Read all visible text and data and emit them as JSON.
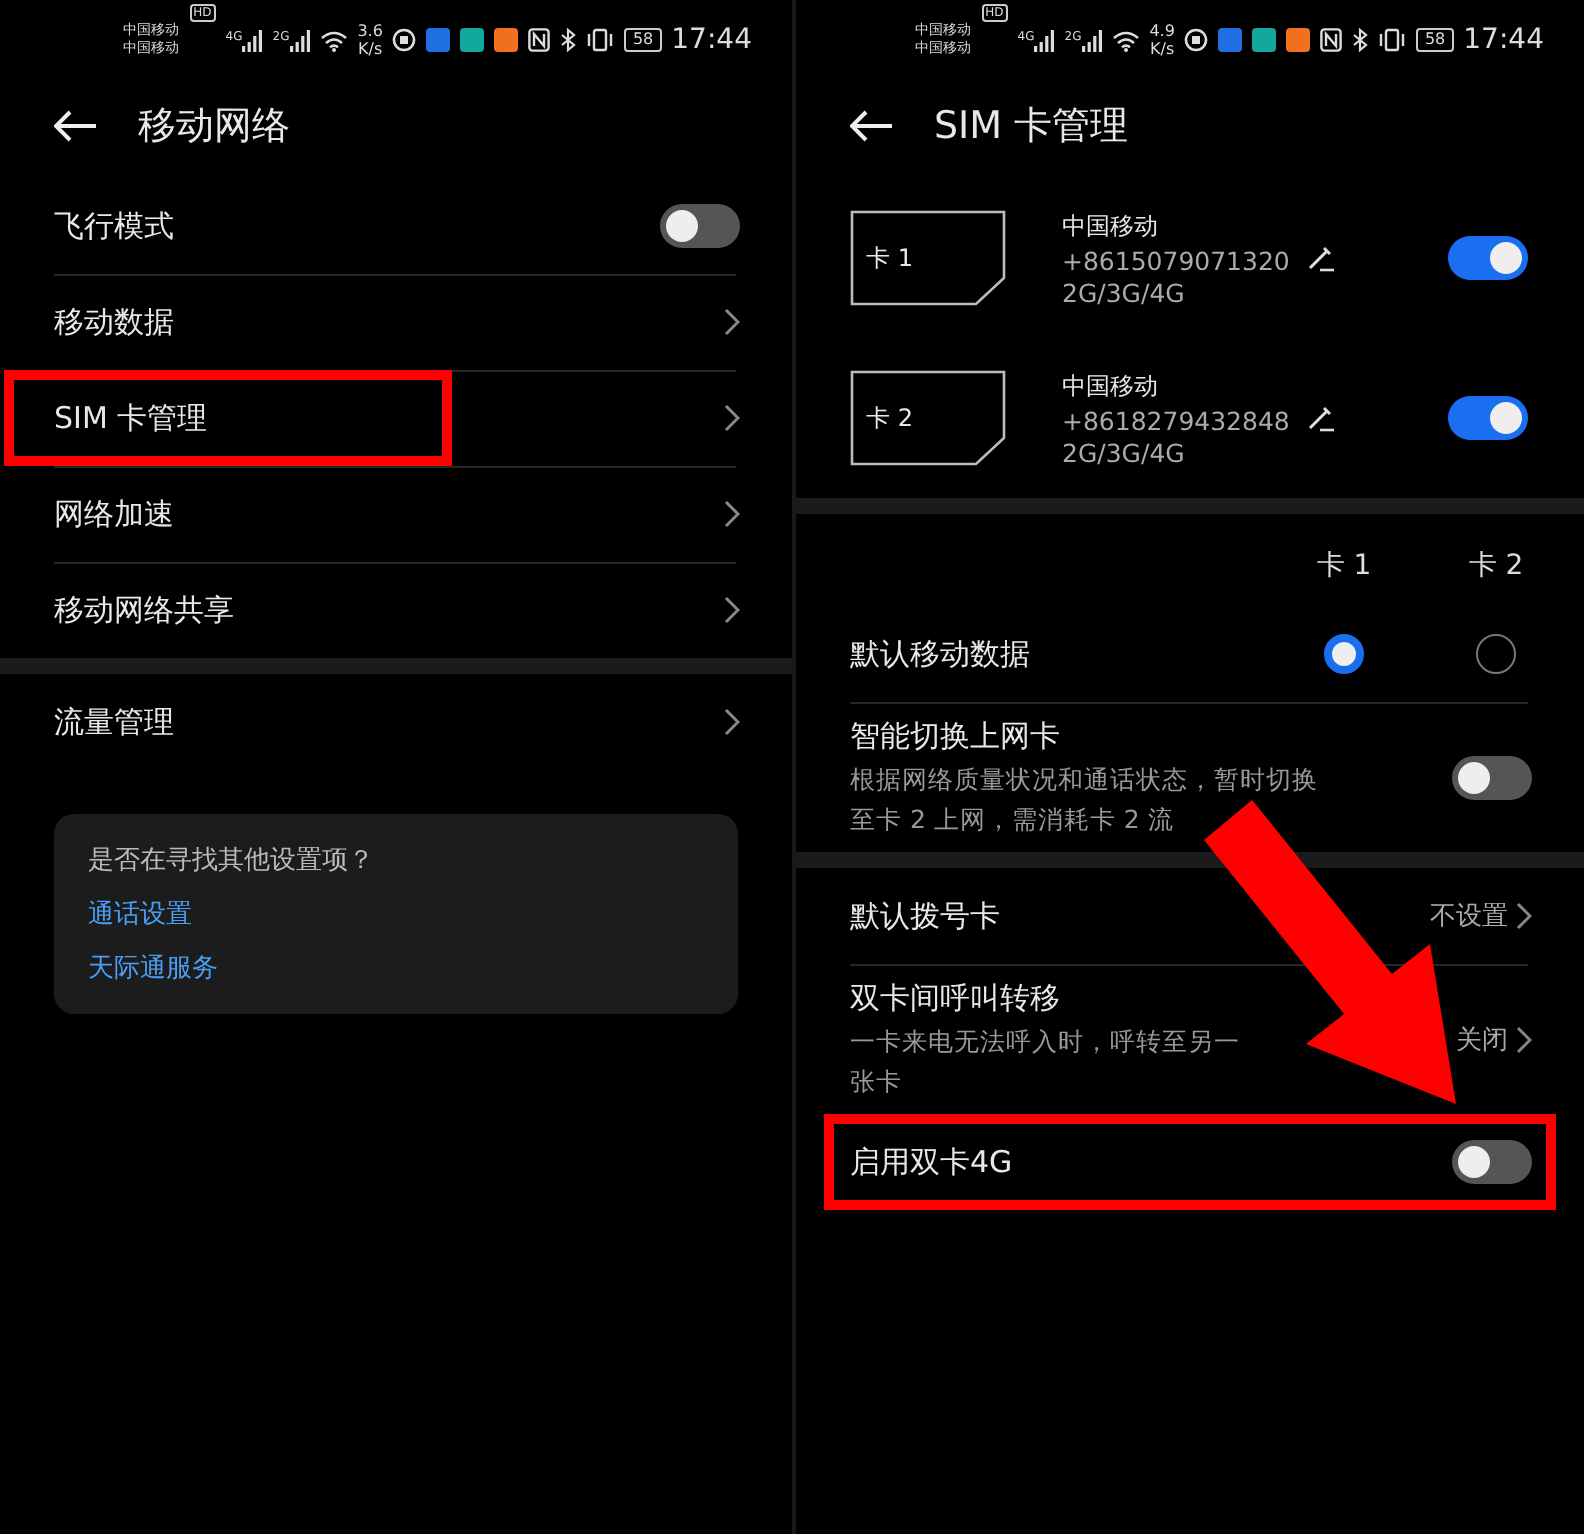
{
  "left_screen": {
    "status_bar": {
      "carrier_1": "中国移动",
      "hd_badge": "HD",
      "carrier_2": "中国移动",
      "signal_1_label": "4G",
      "signal_2_label": "2G",
      "speed": "3.6",
      "speed_unit": "K/s",
      "battery": "58",
      "time": "17:44"
    },
    "title": "移动网络",
    "sections": [
      {
        "rows": [
          {
            "kind": "toggle",
            "label": "飞行模式",
            "on": false,
            "highlighted": false
          },
          {
            "kind": "link",
            "label": "移动数据",
            "highlighted": false
          },
          {
            "kind": "link",
            "label": "SIM 卡管理",
            "highlighted": true
          },
          {
            "kind": "link",
            "label": "网络加速",
            "highlighted": false
          },
          {
            "kind": "link",
            "label": "移动网络共享",
            "highlighted": false
          }
        ]
      },
      {
        "rows": [
          {
            "kind": "link",
            "label": "流量管理",
            "highlighted": false
          }
        ]
      }
    ],
    "suggestion_card": {
      "question": "是否在寻找其他设置项？",
      "links": [
        "通话设置",
        "天际通服务"
      ]
    }
  },
  "right_screen": {
    "status_bar": {
      "carrier_1": "中国移动",
      "hd_badge": "HD",
      "carrier_2": "中国移动",
      "signal_1_label": "4G",
      "signal_2_label": "2G",
      "speed": "4.9",
      "speed_unit": "K/s",
      "battery": "58",
      "time": "17:44"
    },
    "title": "SIM 卡管理",
    "sim_cards": [
      {
        "slot": "卡 1",
        "carrier": "中国移动",
        "number": "+8615079071320",
        "networks": "2G/3G/4G",
        "on": true
      },
      {
        "slot": "卡 2",
        "carrier": "中国移动",
        "number": "+8618279432848",
        "networks": "2G/3G/4G",
        "on": true
      }
    ],
    "sections": [
      {
        "columns": [
          "卡 1",
          "卡 2"
        ],
        "rows": [
          {
            "kind": "radio",
            "label": "默认移动数据",
            "choices": [
              {
                "selected": true
              },
              {
                "selected": false
              }
            ],
            "highlighted": false
          },
          {
            "kind": "toggle",
            "label": "智能切换上网卡",
            "description_lines": [
              "根据网络质量状况和通话状态，暂时切换",
              "至卡 2 上网，需消耗卡 2 流"
            ],
            "on": false,
            "highlighted": false
          }
        ]
      },
      {
        "rows": [
          {
            "kind": "value",
            "label": "默认拨号卡",
            "value": "不设置",
            "highlighted": false
          },
          {
            "kind": "value",
            "label": "双卡间呼叫转移",
            "description_lines": [
              "一卡来电无法呼入时，呼转至另一",
              "张卡"
            ],
            "value": "关闭",
            "highlighted": false
          },
          {
            "kind": "toggle",
            "label": "启用双卡4G",
            "on": false,
            "highlighted": true
          }
        ]
      }
    ]
  }
}
